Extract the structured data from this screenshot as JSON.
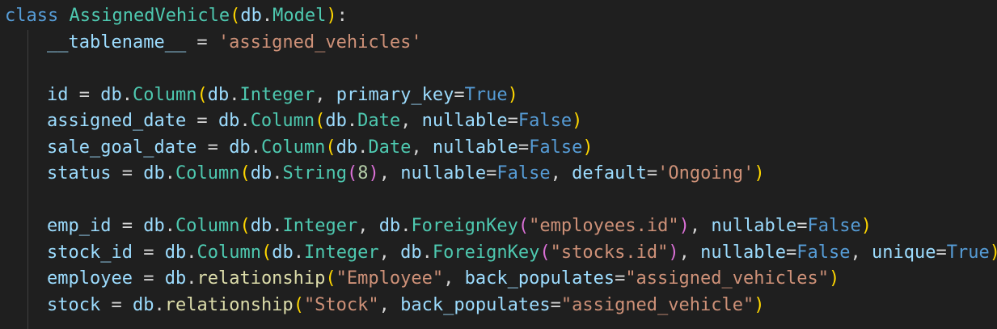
{
  "editor": {
    "background": "#1f1f1f",
    "lines": [
      {
        "tokens": [
          {
            "t": "class",
            "c": "kw"
          },
          {
            "t": " ",
            "c": "op"
          },
          {
            "t": "AssignedVehicle",
            "c": "cls"
          },
          {
            "t": "(",
            "c": "p1"
          },
          {
            "t": "db",
            "c": "var"
          },
          {
            "t": ".",
            "c": "op"
          },
          {
            "t": "Model",
            "c": "cls"
          },
          {
            "t": ")",
            "c": "p1"
          },
          {
            "t": ":",
            "c": "op"
          }
        ]
      },
      {
        "indent": true,
        "tokens": [
          {
            "t": "__tablename__",
            "c": "var"
          },
          {
            "t": " = ",
            "c": "op"
          },
          {
            "t": "'assigned_vehicles'",
            "c": "str"
          }
        ]
      },
      {
        "tokens": []
      },
      {
        "indent": true,
        "tokens": [
          {
            "t": "id",
            "c": "var"
          },
          {
            "t": " = ",
            "c": "op"
          },
          {
            "t": "db",
            "c": "var"
          },
          {
            "t": ".",
            "c": "op"
          },
          {
            "t": "Column",
            "c": "cls"
          },
          {
            "t": "(",
            "c": "p1"
          },
          {
            "t": "db",
            "c": "var"
          },
          {
            "t": ".",
            "c": "op"
          },
          {
            "t": "Integer",
            "c": "cls"
          },
          {
            "t": ", ",
            "c": "op"
          },
          {
            "t": "primary_key",
            "c": "var"
          },
          {
            "t": "=",
            "c": "op"
          },
          {
            "t": "True",
            "c": "const"
          },
          {
            "t": ")",
            "c": "p1"
          }
        ]
      },
      {
        "indent": true,
        "tokens": [
          {
            "t": "assigned_date",
            "c": "var"
          },
          {
            "t": " = ",
            "c": "op"
          },
          {
            "t": "db",
            "c": "var"
          },
          {
            "t": ".",
            "c": "op"
          },
          {
            "t": "Column",
            "c": "cls"
          },
          {
            "t": "(",
            "c": "p1"
          },
          {
            "t": "db",
            "c": "var"
          },
          {
            "t": ".",
            "c": "op"
          },
          {
            "t": "Date",
            "c": "cls"
          },
          {
            "t": ", ",
            "c": "op"
          },
          {
            "t": "nullable",
            "c": "var"
          },
          {
            "t": "=",
            "c": "op"
          },
          {
            "t": "False",
            "c": "const"
          },
          {
            "t": ")",
            "c": "p1"
          }
        ]
      },
      {
        "indent": true,
        "tokens": [
          {
            "t": "sale_goal_date",
            "c": "var"
          },
          {
            "t": " = ",
            "c": "op"
          },
          {
            "t": "db",
            "c": "var"
          },
          {
            "t": ".",
            "c": "op"
          },
          {
            "t": "Column",
            "c": "cls"
          },
          {
            "t": "(",
            "c": "p1"
          },
          {
            "t": "db",
            "c": "var"
          },
          {
            "t": ".",
            "c": "op"
          },
          {
            "t": "Date",
            "c": "cls"
          },
          {
            "t": ", ",
            "c": "op"
          },
          {
            "t": "nullable",
            "c": "var"
          },
          {
            "t": "=",
            "c": "op"
          },
          {
            "t": "False",
            "c": "const"
          },
          {
            "t": ")",
            "c": "p1"
          }
        ]
      },
      {
        "indent": true,
        "tokens": [
          {
            "t": "status",
            "c": "var"
          },
          {
            "t": " = ",
            "c": "op"
          },
          {
            "t": "db",
            "c": "var"
          },
          {
            "t": ".",
            "c": "op"
          },
          {
            "t": "Column",
            "c": "cls"
          },
          {
            "t": "(",
            "c": "p1"
          },
          {
            "t": "db",
            "c": "var"
          },
          {
            "t": ".",
            "c": "op"
          },
          {
            "t": "String",
            "c": "cls"
          },
          {
            "t": "(",
            "c": "p2"
          },
          {
            "t": "8",
            "c": "num"
          },
          {
            "t": ")",
            "c": "p2"
          },
          {
            "t": ", ",
            "c": "op"
          },
          {
            "t": "nullable",
            "c": "var"
          },
          {
            "t": "=",
            "c": "op"
          },
          {
            "t": "False",
            "c": "const"
          },
          {
            "t": ", ",
            "c": "op"
          },
          {
            "t": "default",
            "c": "var"
          },
          {
            "t": "=",
            "c": "op"
          },
          {
            "t": "'Ongoing'",
            "c": "str"
          },
          {
            "t": ")",
            "c": "p1"
          }
        ]
      },
      {
        "tokens": []
      },
      {
        "indent": true,
        "tokens": [
          {
            "t": "emp_id",
            "c": "var"
          },
          {
            "t": " = ",
            "c": "op"
          },
          {
            "t": "db",
            "c": "var"
          },
          {
            "t": ".",
            "c": "op"
          },
          {
            "t": "Column",
            "c": "cls"
          },
          {
            "t": "(",
            "c": "p1"
          },
          {
            "t": "db",
            "c": "var"
          },
          {
            "t": ".",
            "c": "op"
          },
          {
            "t": "Integer",
            "c": "cls"
          },
          {
            "t": ", ",
            "c": "op"
          },
          {
            "t": "db",
            "c": "var"
          },
          {
            "t": ".",
            "c": "op"
          },
          {
            "t": "ForeignKey",
            "c": "cls"
          },
          {
            "t": "(",
            "c": "p2"
          },
          {
            "t": "\"employees.id\"",
            "c": "str"
          },
          {
            "t": ")",
            "c": "p2"
          },
          {
            "t": ", ",
            "c": "op"
          },
          {
            "t": "nullable",
            "c": "var"
          },
          {
            "t": "=",
            "c": "op"
          },
          {
            "t": "False",
            "c": "const"
          },
          {
            "t": ")",
            "c": "p1"
          }
        ]
      },
      {
        "indent": true,
        "tokens": [
          {
            "t": "stock_id",
            "c": "var"
          },
          {
            "t": " = ",
            "c": "op"
          },
          {
            "t": "db",
            "c": "var"
          },
          {
            "t": ".",
            "c": "op"
          },
          {
            "t": "Column",
            "c": "cls"
          },
          {
            "t": "(",
            "c": "p1"
          },
          {
            "t": "db",
            "c": "var"
          },
          {
            "t": ".",
            "c": "op"
          },
          {
            "t": "Integer",
            "c": "cls"
          },
          {
            "t": ", ",
            "c": "op"
          },
          {
            "t": "db",
            "c": "var"
          },
          {
            "t": ".",
            "c": "op"
          },
          {
            "t": "ForeignKey",
            "c": "cls"
          },
          {
            "t": "(",
            "c": "p2"
          },
          {
            "t": "\"stocks.id\"",
            "c": "str"
          },
          {
            "t": ")",
            "c": "p2"
          },
          {
            "t": ", ",
            "c": "op"
          },
          {
            "t": "nullable",
            "c": "var"
          },
          {
            "t": "=",
            "c": "op"
          },
          {
            "t": "False",
            "c": "const"
          },
          {
            "t": ", ",
            "c": "op"
          },
          {
            "t": "unique",
            "c": "var"
          },
          {
            "t": "=",
            "c": "op"
          },
          {
            "t": "True",
            "c": "const"
          },
          {
            "t": ")",
            "c": "p1"
          }
        ]
      },
      {
        "indent": true,
        "tokens": [
          {
            "t": "employee",
            "c": "var"
          },
          {
            "t": " = ",
            "c": "op"
          },
          {
            "t": "db",
            "c": "var"
          },
          {
            "t": ".",
            "c": "op"
          },
          {
            "t": "relationship",
            "c": "fn"
          },
          {
            "t": "(",
            "c": "p1"
          },
          {
            "t": "\"Employee\"",
            "c": "str"
          },
          {
            "t": ", ",
            "c": "op"
          },
          {
            "t": "back_populates",
            "c": "var"
          },
          {
            "t": "=",
            "c": "op"
          },
          {
            "t": "\"assigned_vehicles\"",
            "c": "str"
          },
          {
            "t": ")",
            "c": "p1"
          }
        ]
      },
      {
        "indent": true,
        "tokens": [
          {
            "t": "stock",
            "c": "var"
          },
          {
            "t": " = ",
            "c": "op"
          },
          {
            "t": "db",
            "c": "var"
          },
          {
            "t": ".",
            "c": "op"
          },
          {
            "t": "relationship",
            "c": "fn"
          },
          {
            "t": "(",
            "c": "p1"
          },
          {
            "t": "\"Stock\"",
            "c": "str"
          },
          {
            "t": ", ",
            "c": "op"
          },
          {
            "t": "back_populates",
            "c": "var"
          },
          {
            "t": "=",
            "c": "op"
          },
          {
            "t": "\"assigned_vehicle\"",
            "c": "str"
          },
          {
            "t": ")",
            "c": "p1"
          }
        ]
      }
    ]
  }
}
